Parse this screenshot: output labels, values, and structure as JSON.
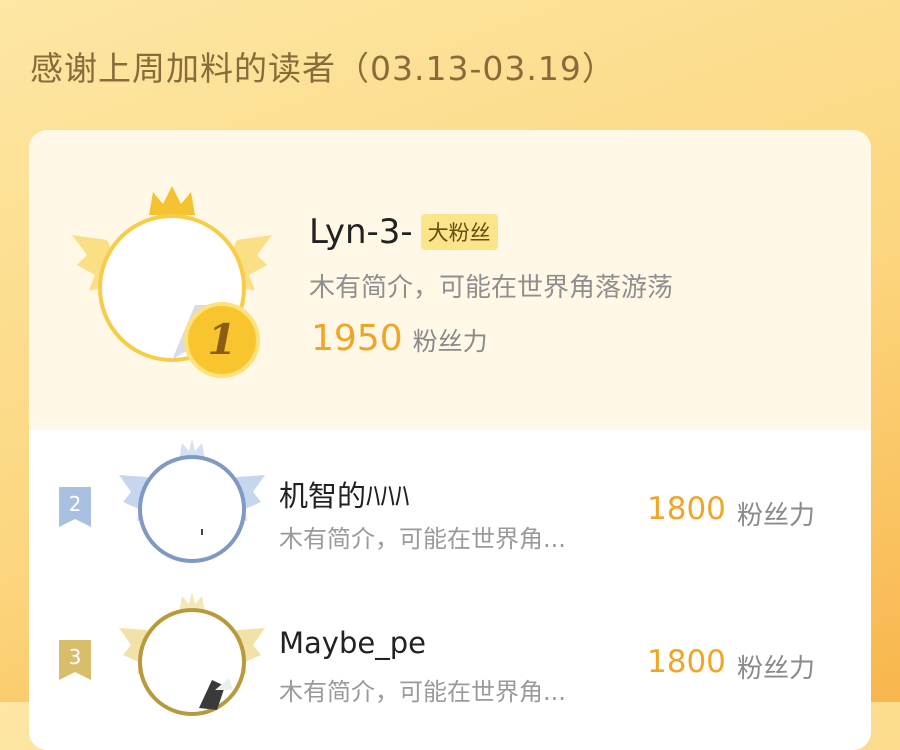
{
  "page": {
    "title": "感谢上周加料的读者（03.13-03.19）"
  },
  "top_reader": {
    "rank": "1",
    "name": "Lyn-3-",
    "badge": "大粉丝",
    "bio": "木有简介，可能在世界角落游荡",
    "score": "1950",
    "score_unit": "粉丝力"
  },
  "readers": [
    {
      "rank": "2",
      "name": "机智的ﾊﾊﾊ",
      "bio": "木有简介，可能在世界角...",
      "score": "1800",
      "score_unit": "粉丝力"
    },
    {
      "rank": "3",
      "name": "Maybe_pe",
      "bio": "木有简介，可能在世界角...",
      "score": "1800",
      "score_unit": "粉丝力"
    }
  ],
  "colors": {
    "gold": "#f0a526",
    "silver": "#8aa4c8",
    "bronze": "#c8a24a"
  }
}
